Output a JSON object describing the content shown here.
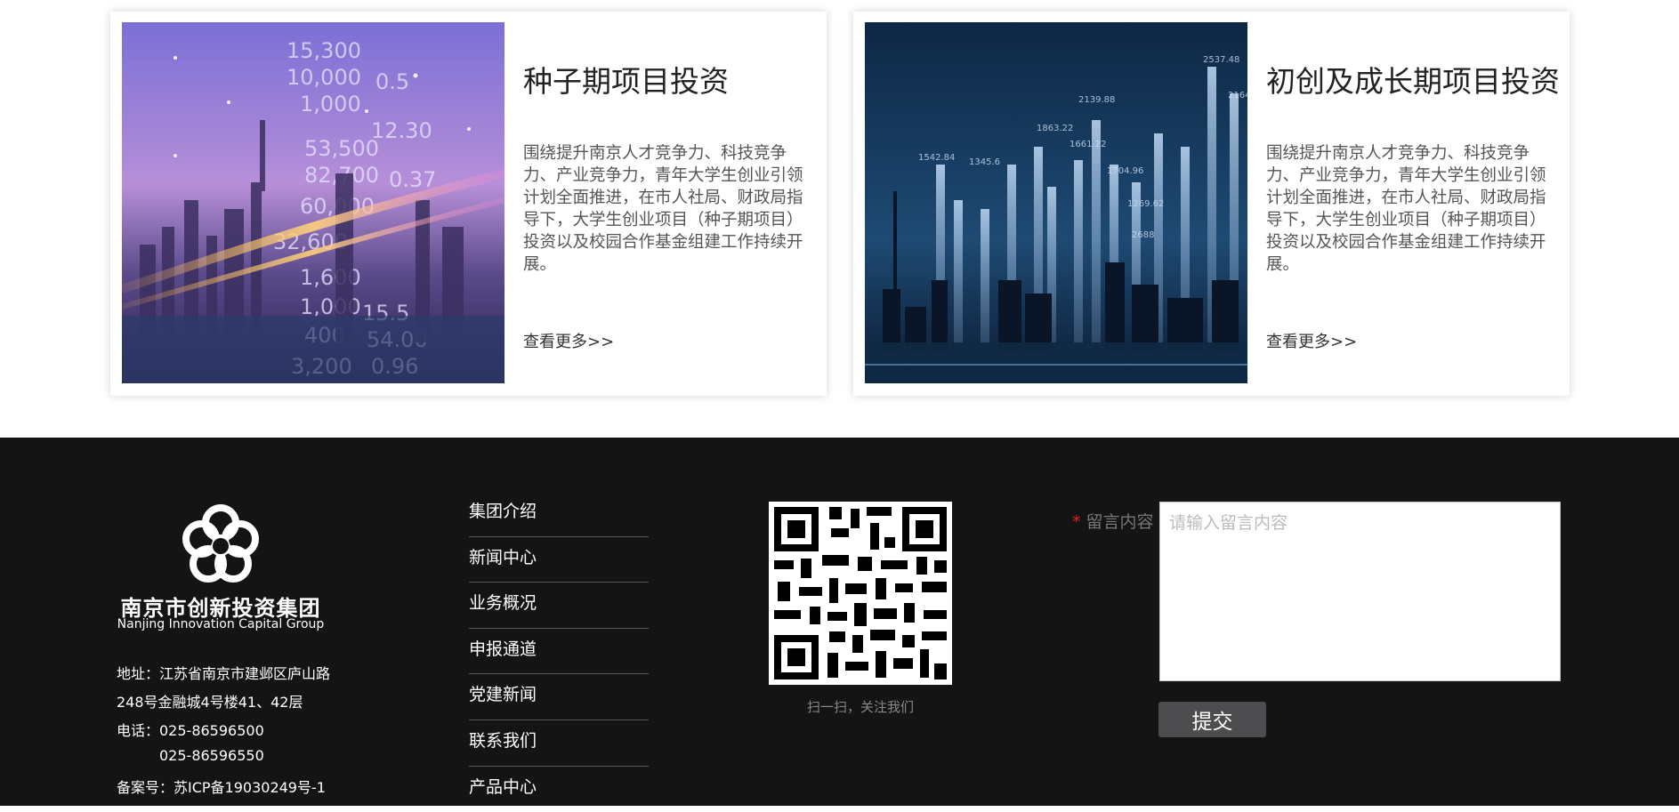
{
  "cards": [
    {
      "title": "种子期项目投资",
      "description": "围绕提升南京人才竞争力、科技竞争力、产业竞争力，青年大学生创业引领计划全面推进，在市人社局、财政局指导下，大学生创业项目（种子期项目）投资以及校园合作基金组建工作持续开展。",
      "more": "查看更多>>"
    },
    {
      "title": "初创及成长期项目投资",
      "description": "围绕提升南京人才竞争力、科技竞争力、产业竞争力，青年大学生创业引领计划全面推进，在市人社局、财政局指导下，大学生创业项目（种子期项目）投资以及校园合作基金组建工作持续开展。",
      "more": "查看更多>>"
    }
  ],
  "footer": {
    "logo": {
      "cn": "南京市创新投资集团",
      "en": "Nanjing Innovation Capital Group"
    },
    "address_lines": [
      "地址：江苏省南京市建邺区庐山路",
      "248号金融城4号楼41、42层",
      "电话：025-86596500",
      "025-86596550",
      "备案号：苏ICP备19030249号-1"
    ],
    "nav": [
      "集团介绍",
      "新闻中心",
      "业务概况",
      "申报通道",
      "党建新闻",
      "联系我们",
      "产品中心"
    ],
    "qr_caption": "扫一扫，关注我们",
    "message": {
      "required_mark": "*",
      "label": "留言内容",
      "placeholder": "请输入留言内容",
      "submit": "提交"
    }
  }
}
